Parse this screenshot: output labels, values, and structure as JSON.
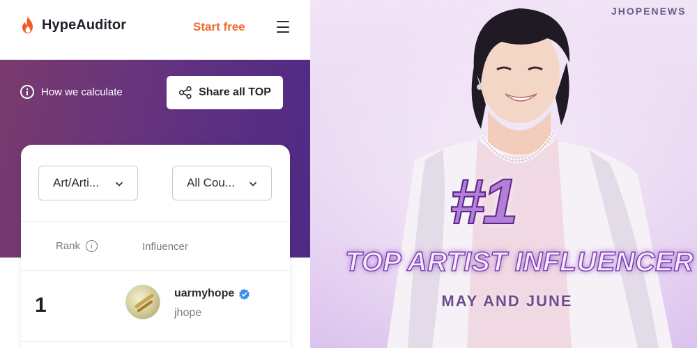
{
  "header": {
    "brand": "HypeAuditor",
    "start_free": "Start free",
    "menu_icon": "hamburger-icon"
  },
  "hero": {
    "how_we_calculate": "How we calculate",
    "share_all_top": "Share all TOP"
  },
  "filters": {
    "category": "Art/Arti...",
    "country": "All Cou..."
  },
  "table": {
    "columns": [
      "Rank",
      "Influencer"
    ],
    "rows": [
      {
        "rank": "1",
        "username": "uarmyhope",
        "name": "jhope",
        "verified": true
      }
    ]
  },
  "promo": {
    "watermark": "JHOPENEWS",
    "rank": "#1",
    "headline": "TOP ARTIST INFLUENCER",
    "subline": "MAY AND JUNE"
  },
  "colors": {
    "accent_orange": "#f06a2c",
    "hero_purple": "#5a2e83",
    "verified_blue": "#3a8ee8",
    "promo_text_purple": "#7b3fb0"
  }
}
